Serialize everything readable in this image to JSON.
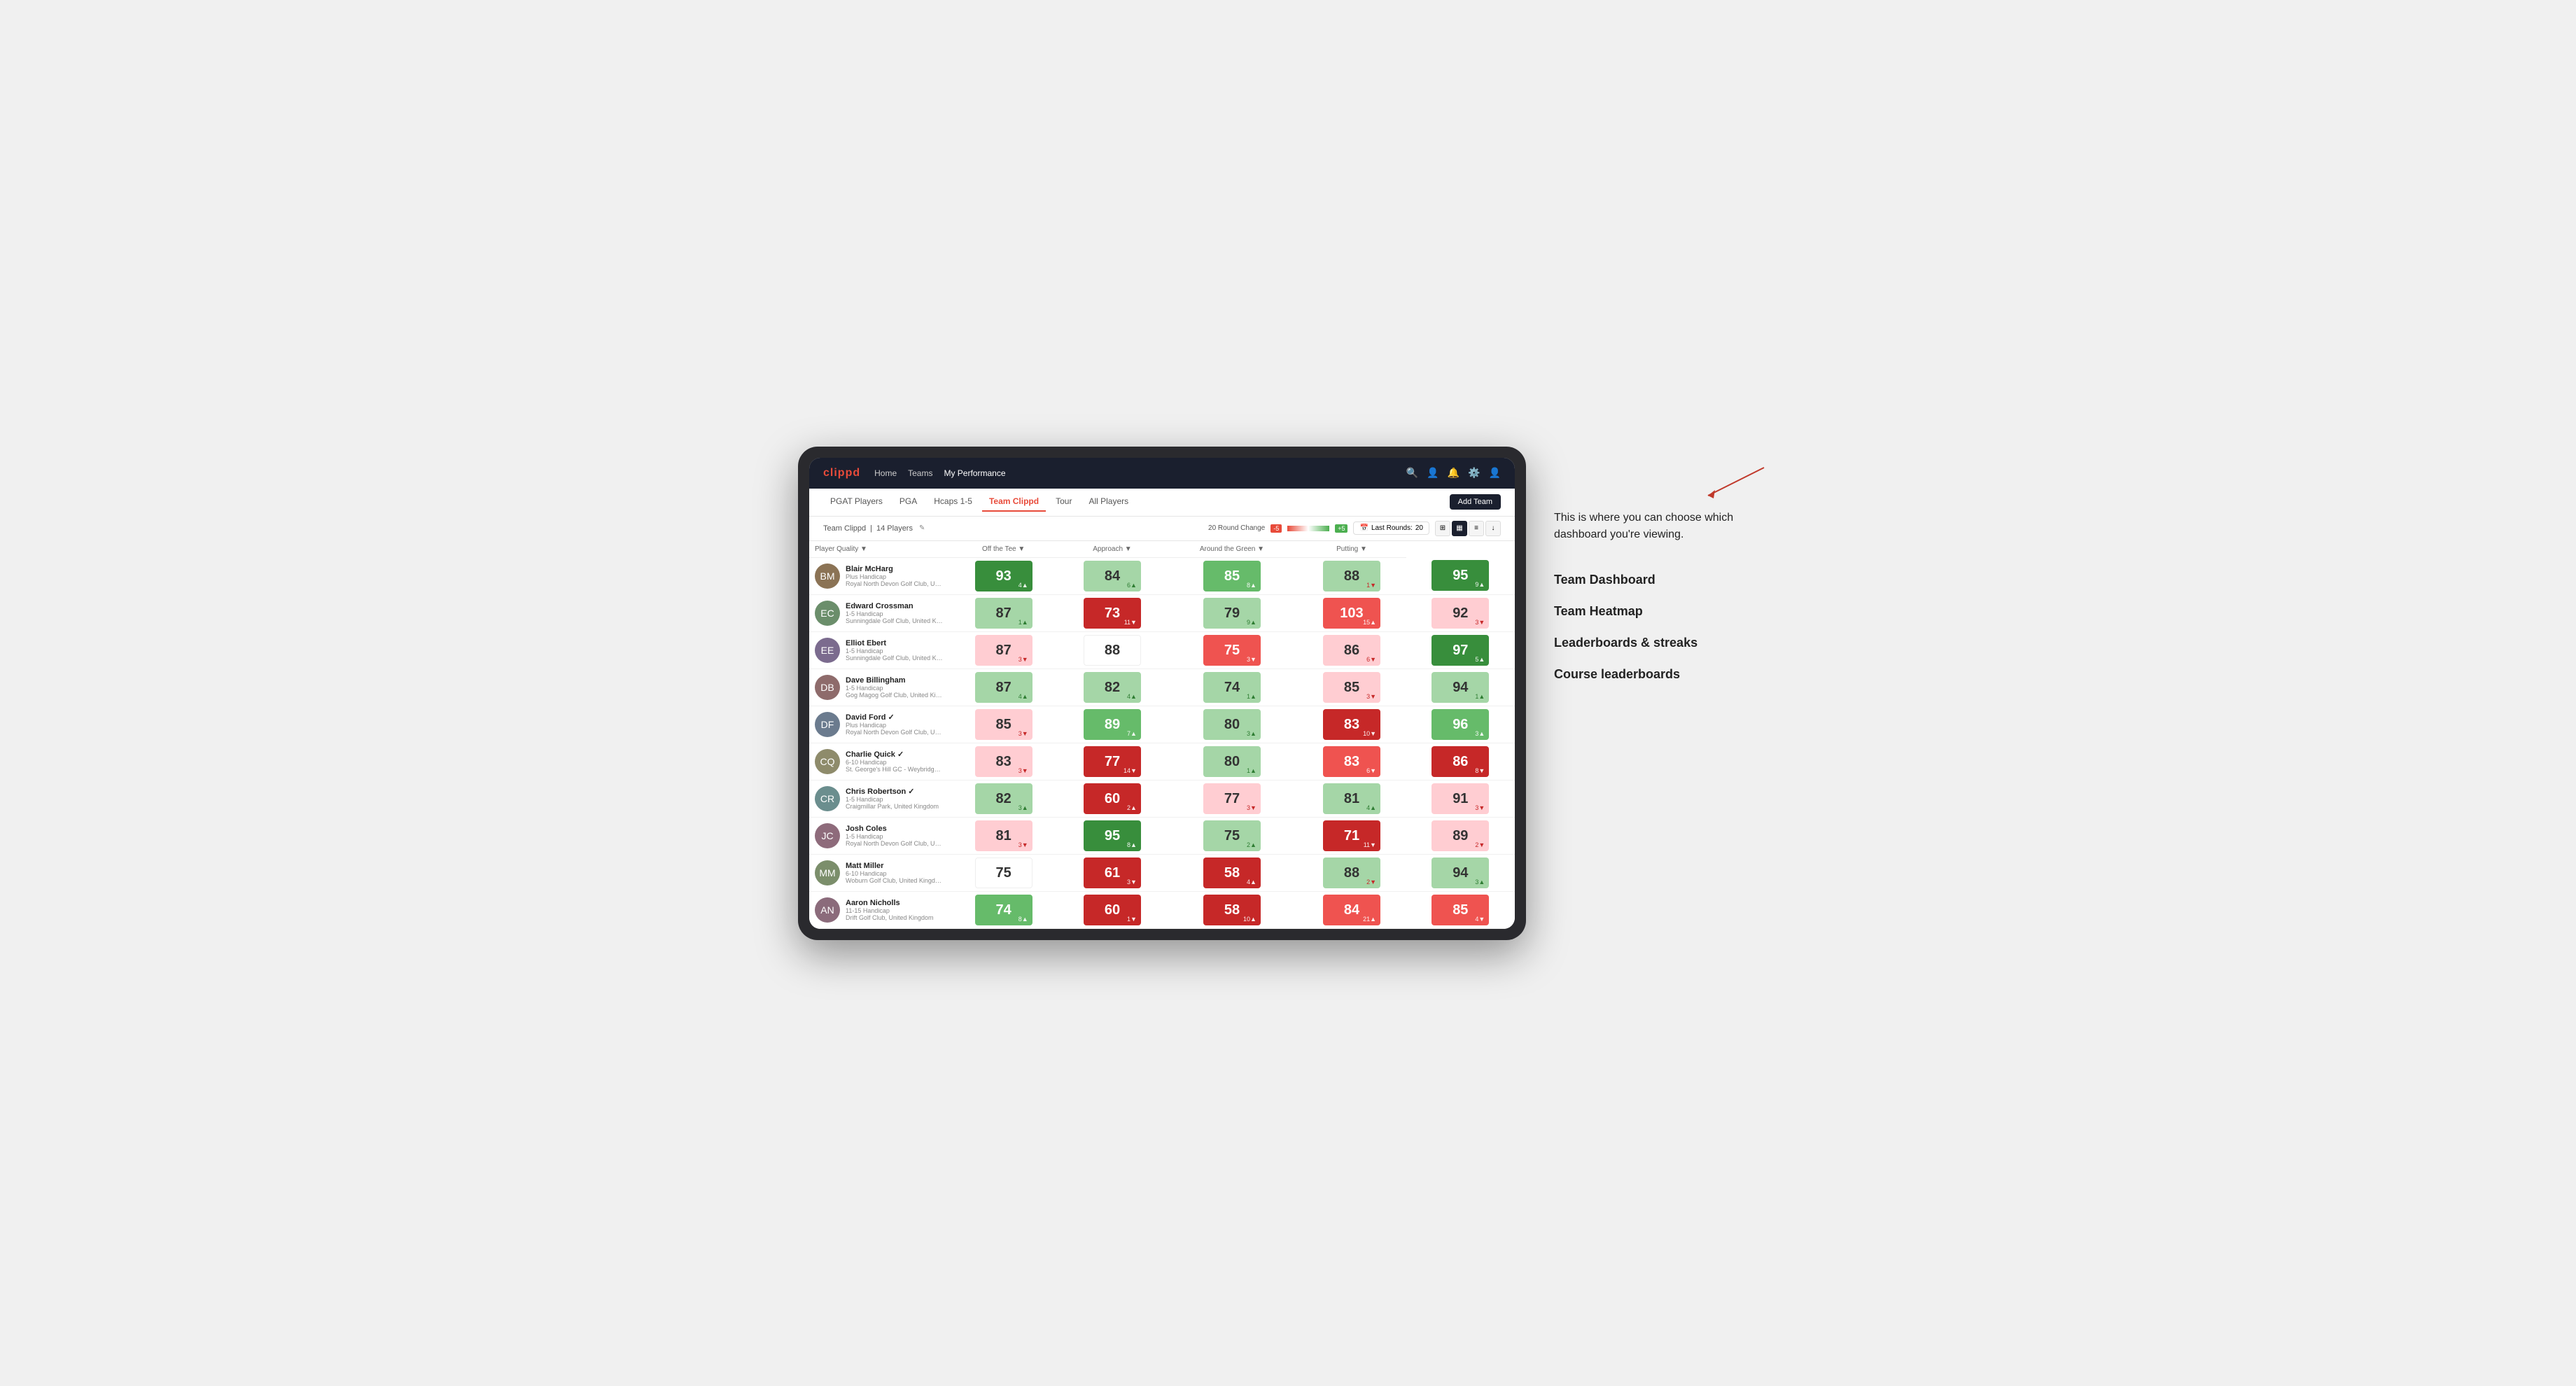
{
  "annotation": {
    "intro_text": "This is where you can choose which dashboard you're viewing.",
    "items": [
      "Team Dashboard",
      "Team Heatmap",
      "Leaderboards & streaks",
      "Course leaderboards"
    ]
  },
  "nav": {
    "logo": "clippd",
    "links": [
      "Home",
      "Teams",
      "My Performance"
    ],
    "active_link": "My Performance"
  },
  "sub_nav": {
    "links": [
      "PGAT Players",
      "PGA",
      "Hcaps 1-5",
      "Team Clippd",
      "Tour",
      "All Players"
    ],
    "active_link": "Team Clippd",
    "add_team_label": "Add Team"
  },
  "team_info": {
    "name": "Team Clippd",
    "player_count": "14 Players",
    "round_change_label": "20 Round Change",
    "change_neg": "-5",
    "change_pos": "+5",
    "last_rounds_label": "Last Rounds:",
    "last_rounds_value": "20"
  },
  "table": {
    "columns": [
      "Player Quality ▼",
      "Off the Tee ▼",
      "Approach ▼",
      "Around the Green ▼",
      "Putting ▼"
    ],
    "players": [
      {
        "name": "Blair McHarg",
        "handicap": "Plus Handicap",
        "club": "Royal North Devon Golf Club, United Kingdom",
        "initials": "BM",
        "stats": [
          {
            "value": "93",
            "change": "4▲",
            "direction": "up",
            "color": "bg-green-dark"
          },
          {
            "value": "84",
            "change": "6▲",
            "direction": "up",
            "color": "bg-green-light"
          },
          {
            "value": "85",
            "change": "8▲",
            "direction": "up",
            "color": "bg-green-mid"
          },
          {
            "value": "88",
            "change": "1▼",
            "direction": "down",
            "color": "bg-green-light"
          },
          {
            "value": "95",
            "change": "9▲",
            "direction": "up",
            "color": "bg-green-dark"
          }
        ]
      },
      {
        "name": "Edward Crossman",
        "handicap": "1-5 Handicap",
        "club": "Sunningdale Golf Club, United Kingdom",
        "initials": "EC",
        "stats": [
          {
            "value": "87",
            "change": "1▲",
            "direction": "up",
            "color": "bg-green-light"
          },
          {
            "value": "73",
            "change": "11▼",
            "direction": "down",
            "color": "bg-red-dark"
          },
          {
            "value": "79",
            "change": "9▲",
            "direction": "up",
            "color": "bg-green-light"
          },
          {
            "value": "103",
            "change": "15▲",
            "direction": "up",
            "color": "bg-red-mid"
          },
          {
            "value": "92",
            "change": "3▼",
            "direction": "down",
            "color": "bg-red-light"
          }
        ]
      },
      {
        "name": "Elliot Ebert",
        "handicap": "1-5 Handicap",
        "club": "Sunningdale Golf Club, United Kingdom",
        "initials": "EE",
        "stats": [
          {
            "value": "87",
            "change": "3▼",
            "direction": "down",
            "color": "bg-red-light"
          },
          {
            "value": "88",
            "change": "",
            "direction": "",
            "color": "bg-white"
          },
          {
            "value": "75",
            "change": "3▼",
            "direction": "down",
            "color": "bg-red-mid"
          },
          {
            "value": "86",
            "change": "6▼",
            "direction": "down",
            "color": "bg-red-light"
          },
          {
            "value": "97",
            "change": "5▲",
            "direction": "up",
            "color": "bg-green-dark"
          }
        ]
      },
      {
        "name": "Dave Billingham",
        "handicap": "1-5 Handicap",
        "club": "Gog Magog Golf Club, United Kingdom",
        "initials": "DB",
        "stats": [
          {
            "value": "87",
            "change": "4▲",
            "direction": "up",
            "color": "bg-green-light"
          },
          {
            "value": "82",
            "change": "4▲",
            "direction": "up",
            "color": "bg-green-light"
          },
          {
            "value": "74",
            "change": "1▲",
            "direction": "up",
            "color": "bg-green-light"
          },
          {
            "value": "85",
            "change": "3▼",
            "direction": "down",
            "color": "bg-red-light"
          },
          {
            "value": "94",
            "change": "1▲",
            "direction": "up",
            "color": "bg-green-light"
          }
        ]
      },
      {
        "name": "David Ford ✓",
        "handicap": "Plus Handicap",
        "club": "Royal North Devon Golf Club, United Kingdom",
        "initials": "DF",
        "stats": [
          {
            "value": "85",
            "change": "3▼",
            "direction": "down",
            "color": "bg-red-light"
          },
          {
            "value": "89",
            "change": "7▲",
            "direction": "up",
            "color": "bg-green-mid"
          },
          {
            "value": "80",
            "change": "3▲",
            "direction": "up",
            "color": "bg-green-light"
          },
          {
            "value": "83",
            "change": "10▼",
            "direction": "down",
            "color": "bg-red-dark"
          },
          {
            "value": "96",
            "change": "3▲",
            "direction": "up",
            "color": "bg-green-mid"
          }
        ]
      },
      {
        "name": "Charlie Quick ✓",
        "handicap": "6-10 Handicap",
        "club": "St. George's Hill GC - Weybridge - Surrey, Uni...",
        "initials": "CQ",
        "stats": [
          {
            "value": "83",
            "change": "3▼",
            "direction": "down",
            "color": "bg-red-light"
          },
          {
            "value": "77",
            "change": "14▼",
            "direction": "down",
            "color": "bg-red-dark"
          },
          {
            "value": "80",
            "change": "1▲",
            "direction": "up",
            "color": "bg-green-light"
          },
          {
            "value": "83",
            "change": "6▼",
            "direction": "down",
            "color": "bg-red-mid"
          },
          {
            "value": "86",
            "change": "8▼",
            "direction": "down",
            "color": "bg-red-dark"
          }
        ]
      },
      {
        "name": "Chris Robertson ✓",
        "handicap": "1-5 Handicap",
        "club": "Craigmillar Park, United Kingdom",
        "initials": "CR",
        "stats": [
          {
            "value": "82",
            "change": "3▲",
            "direction": "up",
            "color": "bg-green-light"
          },
          {
            "value": "60",
            "change": "2▲",
            "direction": "up",
            "color": "bg-red-dark"
          },
          {
            "value": "77",
            "change": "3▼",
            "direction": "down",
            "color": "bg-red-light"
          },
          {
            "value": "81",
            "change": "4▲",
            "direction": "up",
            "color": "bg-green-light"
          },
          {
            "value": "91",
            "change": "3▼",
            "direction": "down",
            "color": "bg-red-light"
          }
        ]
      },
      {
        "name": "Josh Coles",
        "handicap": "1-5 Handicap",
        "club": "Royal North Devon Golf Club, United Kingdom",
        "initials": "JC",
        "stats": [
          {
            "value": "81",
            "change": "3▼",
            "direction": "down",
            "color": "bg-red-light"
          },
          {
            "value": "95",
            "change": "8▲",
            "direction": "up",
            "color": "bg-green-dark"
          },
          {
            "value": "75",
            "change": "2▲",
            "direction": "up",
            "color": "bg-green-light"
          },
          {
            "value": "71",
            "change": "11▼",
            "direction": "down",
            "color": "bg-red-dark"
          },
          {
            "value": "89",
            "change": "2▼",
            "direction": "down",
            "color": "bg-red-light"
          }
        ]
      },
      {
        "name": "Matt Miller",
        "handicap": "6-10 Handicap",
        "club": "Woburn Golf Club, United Kingdom",
        "initials": "MM",
        "stats": [
          {
            "value": "75",
            "change": "",
            "direction": "",
            "color": "bg-white"
          },
          {
            "value": "61",
            "change": "3▼",
            "direction": "down",
            "color": "bg-red-dark"
          },
          {
            "value": "58",
            "change": "4▲",
            "direction": "up",
            "color": "bg-red-dark"
          },
          {
            "value": "88",
            "change": "2▼",
            "direction": "down",
            "color": "bg-green-light"
          },
          {
            "value": "94",
            "change": "3▲",
            "direction": "up",
            "color": "bg-green-light"
          }
        ]
      },
      {
        "name": "Aaron Nicholls",
        "handicap": "11-15 Handicap",
        "club": "Drift Golf Club, United Kingdom",
        "initials": "AN",
        "stats": [
          {
            "value": "74",
            "change": "8▲",
            "direction": "up",
            "color": "bg-green-mid"
          },
          {
            "value": "60",
            "change": "1▼",
            "direction": "down",
            "color": "bg-red-dark"
          },
          {
            "value": "58",
            "change": "10▲",
            "direction": "up",
            "color": "bg-red-dark"
          },
          {
            "value": "84",
            "change": "21▲",
            "direction": "up",
            "color": "bg-red-mid"
          },
          {
            "value": "85",
            "change": "4▼",
            "direction": "down",
            "color": "bg-red-mid"
          }
        ]
      }
    ]
  }
}
